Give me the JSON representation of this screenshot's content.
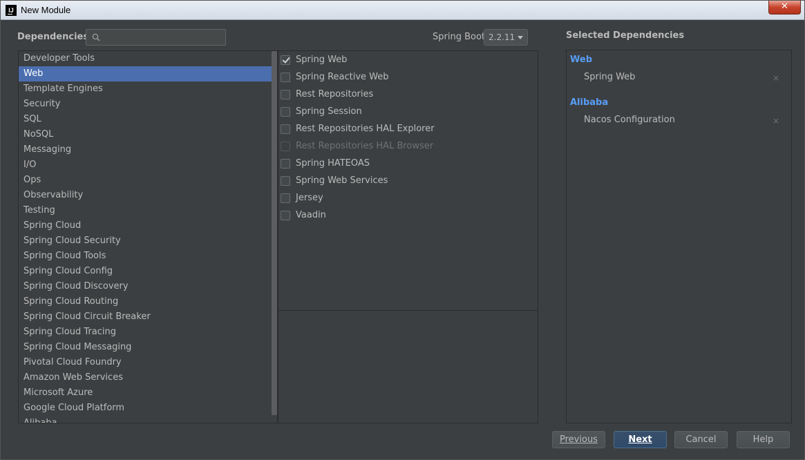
{
  "window": {
    "title": "New Module",
    "app_icon": "IJ",
    "close_label": "✕"
  },
  "header": {
    "dependencies_label": "Dependencies",
    "search_placeholder": "",
    "spring_boot_label": "Spring Boot",
    "spring_boot_version": "2.2.11",
    "selected_dependencies_label": "Selected Dependencies"
  },
  "categories": [
    "Developer Tools",
    "Web",
    "Template Engines",
    "Security",
    "SQL",
    "NoSQL",
    "Messaging",
    "I/O",
    "Ops",
    "Observability",
    "Testing",
    "Spring Cloud",
    "Spring Cloud Security",
    "Spring Cloud Tools",
    "Spring Cloud Config",
    "Spring Cloud Discovery",
    "Spring Cloud Routing",
    "Spring Cloud Circuit Breaker",
    "Spring Cloud Tracing",
    "Spring Cloud Messaging",
    "Pivotal Cloud Foundry",
    "Amazon Web Services",
    "Microsoft Azure",
    "Google Cloud Platform",
    "Alibaba"
  ],
  "selected_category": "Web",
  "dependencies": [
    {
      "label": "Spring Web",
      "checked": true,
      "enabled": true
    },
    {
      "label": "Spring Reactive Web",
      "checked": false,
      "enabled": true
    },
    {
      "label": "Rest Repositories",
      "checked": false,
      "enabled": true
    },
    {
      "label": "Spring Session",
      "checked": false,
      "enabled": true
    },
    {
      "label": "Rest Repositories HAL Explorer",
      "checked": false,
      "enabled": true
    },
    {
      "label": "Rest Repositories HAL Browser",
      "checked": false,
      "enabled": false
    },
    {
      "label": "Spring HATEOAS",
      "checked": false,
      "enabled": true
    },
    {
      "label": "Spring Web Services",
      "checked": false,
      "enabled": true
    },
    {
      "label": "Jersey",
      "checked": false,
      "enabled": true
    },
    {
      "label": "Vaadin",
      "checked": false,
      "enabled": true
    }
  ],
  "selected": [
    {
      "group": "Web",
      "items": [
        "Spring Web"
      ]
    },
    {
      "group": "Alibaba",
      "items": [
        "Nacos Configuration"
      ]
    }
  ],
  "buttons": {
    "previous": "Previous",
    "next": "Next",
    "cancel": "Cancel",
    "help": "Help"
  },
  "colors": {
    "selection": "#4b6eaf",
    "group_heading": "#589df6",
    "background": "#3c3f41"
  }
}
